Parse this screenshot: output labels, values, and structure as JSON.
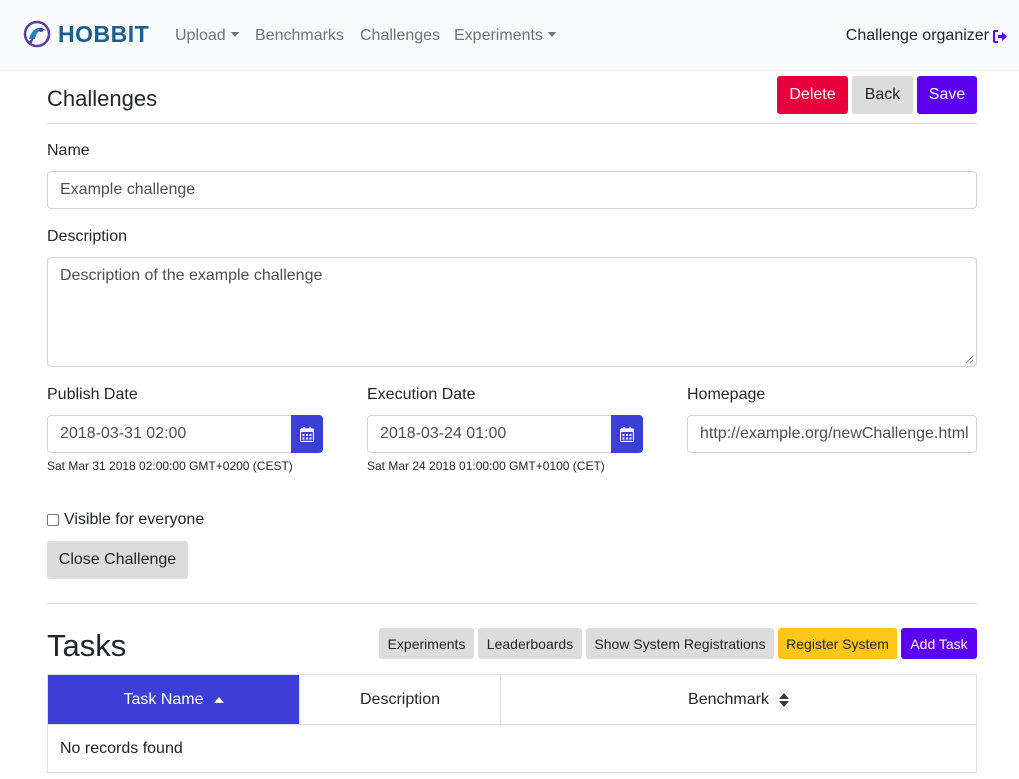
{
  "nav": {
    "brand": "HOBBIT",
    "items": [
      {
        "label": "Upload",
        "dropdown": true
      },
      {
        "label": "Benchmarks",
        "dropdown": false
      },
      {
        "label": "Challenges",
        "dropdown": false
      },
      {
        "label": "Experiments",
        "dropdown": true
      }
    ],
    "user": "Challenge organizer",
    "user_icon": "sign-out-icon"
  },
  "header": {
    "title": "Challenges",
    "delete_label": "Delete",
    "back_label": "Back",
    "save_label": "Save"
  },
  "form": {
    "name_label": "Name",
    "name_value": "Example challenge",
    "description_label": "Description",
    "description_value": "Description of the example challenge",
    "publish_label": "Publish Date",
    "publish_value": "2018-03-31 02:00",
    "publish_hint": "Sat Mar 31 2018 02:00:00 GMT+0200 (CEST)",
    "execution_label": "Execution Date",
    "execution_value": "2018-03-24 01:00",
    "execution_hint": "Sat Mar 24 2018 01:00:00 GMT+0100 (CET)",
    "homepage_label": "Homepage",
    "homepage_value": "http://example.org/newChallenge.html",
    "visible_label": "Visible for everyone",
    "visible_checked": false,
    "close_label": "Close Challenge"
  },
  "tasks": {
    "title": "Tasks",
    "buttons": {
      "experiments": "Experiments",
      "leaderboards": "Leaderboards",
      "show_registrations": "Show System Registrations",
      "register_system": "Register System",
      "add_task": "Add Task"
    },
    "columns": [
      "Task Name",
      "Description",
      "Benchmark"
    ],
    "empty_text": "No records found"
  },
  "colors": {
    "primary": "#5c00f2",
    "danger": "#e8003d",
    "warning": "#ffc61a",
    "accent_blue": "#3b3fd8",
    "brand": "#1b5f8c"
  }
}
